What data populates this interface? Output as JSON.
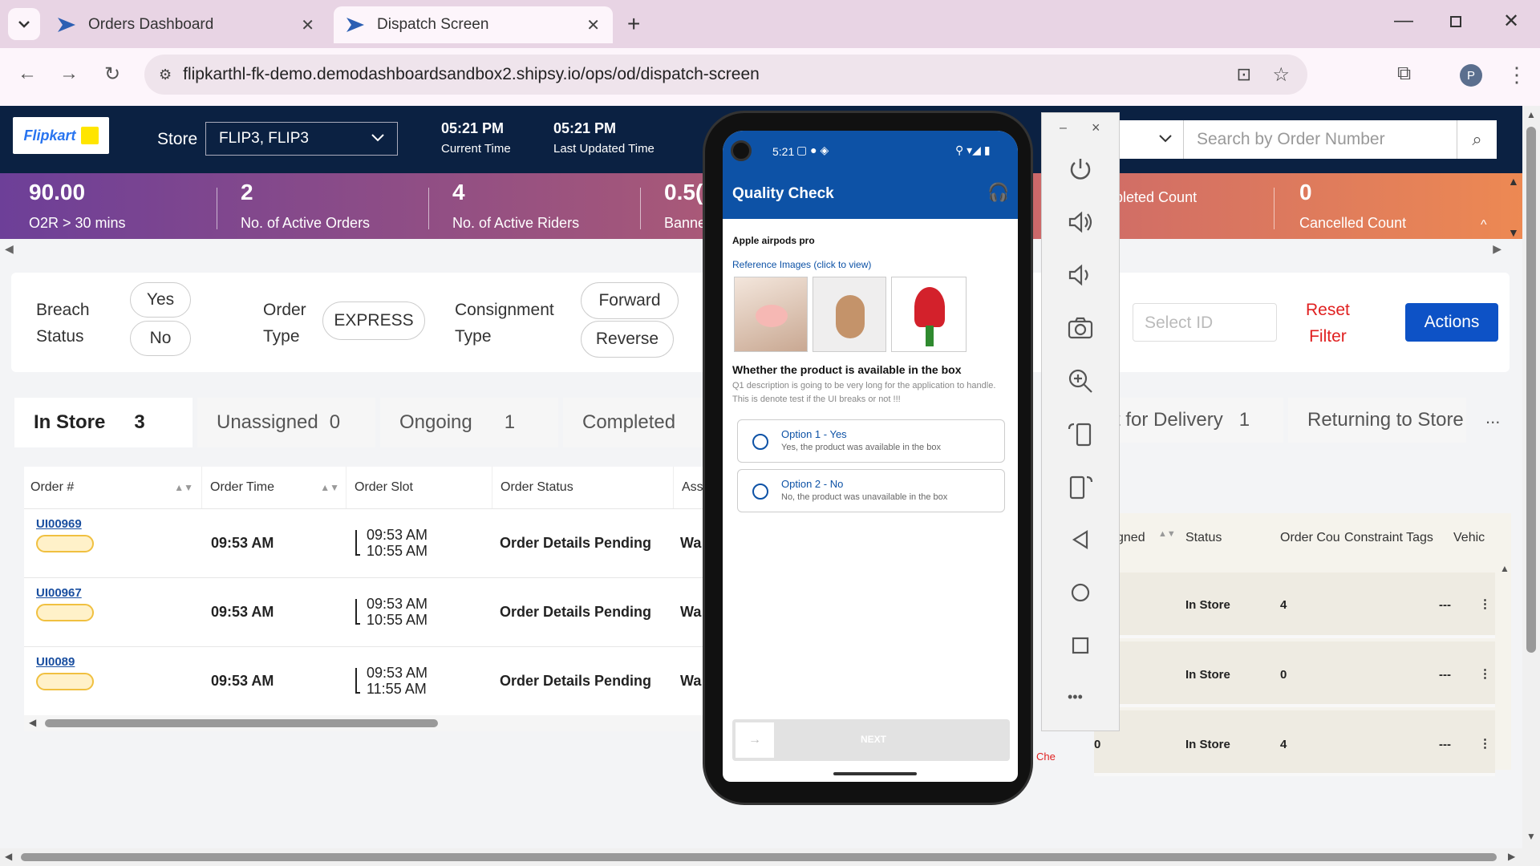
{
  "browser": {
    "tabs": [
      {
        "label": "Orders Dashboard"
      },
      {
        "label": "Dispatch Screen"
      }
    ],
    "url": "flipkarthl-fk-demo.demodashboardsandbox2.shipsy.io/ops/od/dispatch-screen",
    "profile_initial": "P"
  },
  "header": {
    "logo": "Flipkart",
    "store_label": "Store",
    "store_value": "FLIP3, FLIP3",
    "current_time": "05:21 PM",
    "current_time_label": "Current Time",
    "updated_time": "05:21 PM",
    "updated_time_label": "Last Updated Time",
    "search_placeholder": "Search by Order Number"
  },
  "metrics": [
    {
      "value": "90.00",
      "label": "O2R > 30 mins"
    },
    {
      "value": "2",
      "label": "No. of Active Orders"
    },
    {
      "value": "4",
      "label": "No. of Active Riders"
    },
    {
      "value": "0.5(",
      "label": "Banne"
    },
    {
      "value": "",
      "label": "pleted Count"
    },
    {
      "value": "0",
      "label": "Cancelled Count"
    }
  ],
  "filters": {
    "breach_label_1": "Breach",
    "breach_label_2": "Status",
    "yes": "Yes",
    "no": "No",
    "order_label_1": "Order",
    "order_label_2": "Type",
    "express": "EXPRESS",
    "consign_label_1": "Consignment",
    "consign_label_2": "Type",
    "forward": "Forward",
    "reverse": "Reverse",
    "select_id_placeholder": "Select ID",
    "reset_1": "Reset",
    "reset_2": "Filter",
    "actions": "Actions"
  },
  "status_tabs": [
    {
      "label": "In Store",
      "count": "3"
    },
    {
      "label": "Unassigned",
      "count": "0"
    },
    {
      "label": "Ongoing",
      "count": "1"
    },
    {
      "label": "Completed",
      "count": ""
    },
    {
      "label": "t for Delivery",
      "count": "1"
    },
    {
      "label": "Returning to Store",
      "count": ""
    }
  ],
  "more": "...",
  "table": {
    "headers": [
      "Order #",
      "Order Time",
      "Order Slot",
      "Order Status",
      "Assi"
    ],
    "rows": [
      {
        "id": "UI00969",
        "time": "09:53 AM",
        "slot_from": "09:53 AM",
        "slot_to": "10:55 AM",
        "status": "Order Details Pending",
        "assign": "Wa"
      },
      {
        "id": "UI00967",
        "time": "09:53 AM",
        "slot_from": "09:53 AM",
        "slot_to": "10:55 AM",
        "status": "Order Details Pending",
        "assign": "Wa"
      },
      {
        "id": "UI0089",
        "time": "09:53 AM",
        "slot_from": "09:53 AM",
        "slot_to": "11:55 AM",
        "status": "Order Details Pending",
        "assign": "Wa"
      }
    ]
  },
  "rider_table": {
    "headers": [
      "gned",
      "Status",
      "Order Cou",
      "Constraint Tags",
      "Vehic"
    ],
    "rows": [
      {
        "assigned": "",
        "status": "In Store",
        "count": "4",
        "tags": "---"
      },
      {
        "assigned": "",
        "status": "In Store",
        "count": "0",
        "tags": "---"
      },
      {
        "assigned": "0",
        "status": "In Store",
        "count": "4",
        "tags": "---"
      }
    ],
    "fragment": "Che"
  },
  "phone": {
    "time": "5:21",
    "title": "Quality Check",
    "product": "Apple airpods pro",
    "ref_images": "Reference Images (click to view)",
    "question": "Whether the product is available in the box",
    "description": "Q1 description is going to be very long for the application to handle. This is denote test if the UI breaks or not !!!",
    "options": [
      {
        "title": "Option 1 - Yes",
        "sub": "Yes, the product was available in the box"
      },
      {
        "title": "Option 2 - No",
        "sub": "No, the product was unavailable in the box"
      }
    ],
    "next": "NEXT"
  },
  "emulator": {
    "minimize": "–",
    "close": "×",
    "more": "•••"
  },
  "colors": {
    "header": "#0b2142",
    "accent": "#0d52a6",
    "actions": "#0d52c6",
    "reset": "#e02020"
  }
}
